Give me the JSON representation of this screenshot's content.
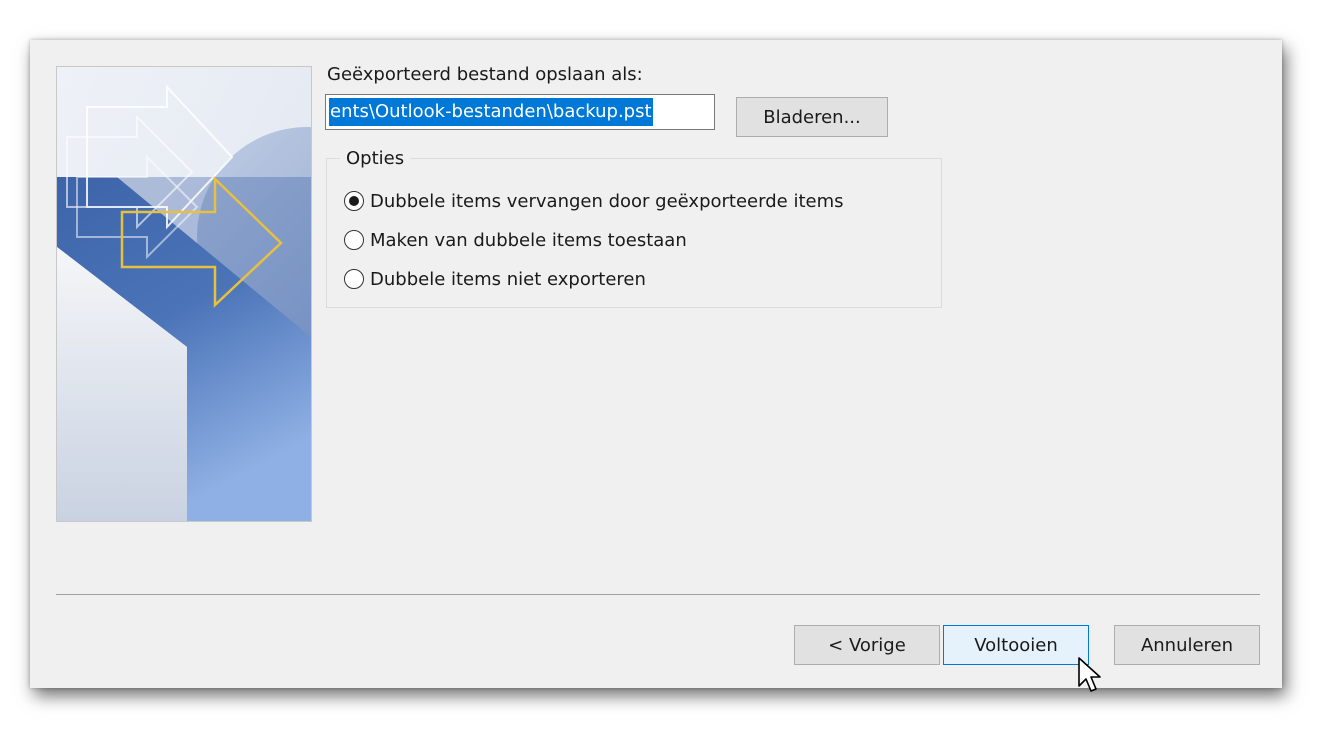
{
  "export": {
    "file_label": "Geëxporteerd bestand opslaan als:",
    "file_path": "ents\\Outlook-bestanden\\backup.pst",
    "browse_label": "Bladeren..."
  },
  "options": {
    "legend": "Opties",
    "items": [
      {
        "label": "Dubbele items vervangen door geëxporteerde items",
        "checked": true
      },
      {
        "label": "Maken van dubbele items toestaan",
        "checked": false
      },
      {
        "label": "Dubbele items niet exporteren",
        "checked": false
      }
    ]
  },
  "footer": {
    "back_label": "< Vorige",
    "finish_label": "Voltooien",
    "cancel_label": "Annuleren"
  },
  "colors": {
    "dialog_bg": "#f0f0f0",
    "selection": "#0078d7",
    "button_bg": "#e1e1e1",
    "finish_hover_bg": "#e5f1fb",
    "image_blue_dark": "#2f5aa0",
    "image_arrow_gold": "#e8c040"
  },
  "icons": {
    "side_image": "outlook-export-wizard-graphic",
    "cursor": "mouse-pointer-icon"
  }
}
